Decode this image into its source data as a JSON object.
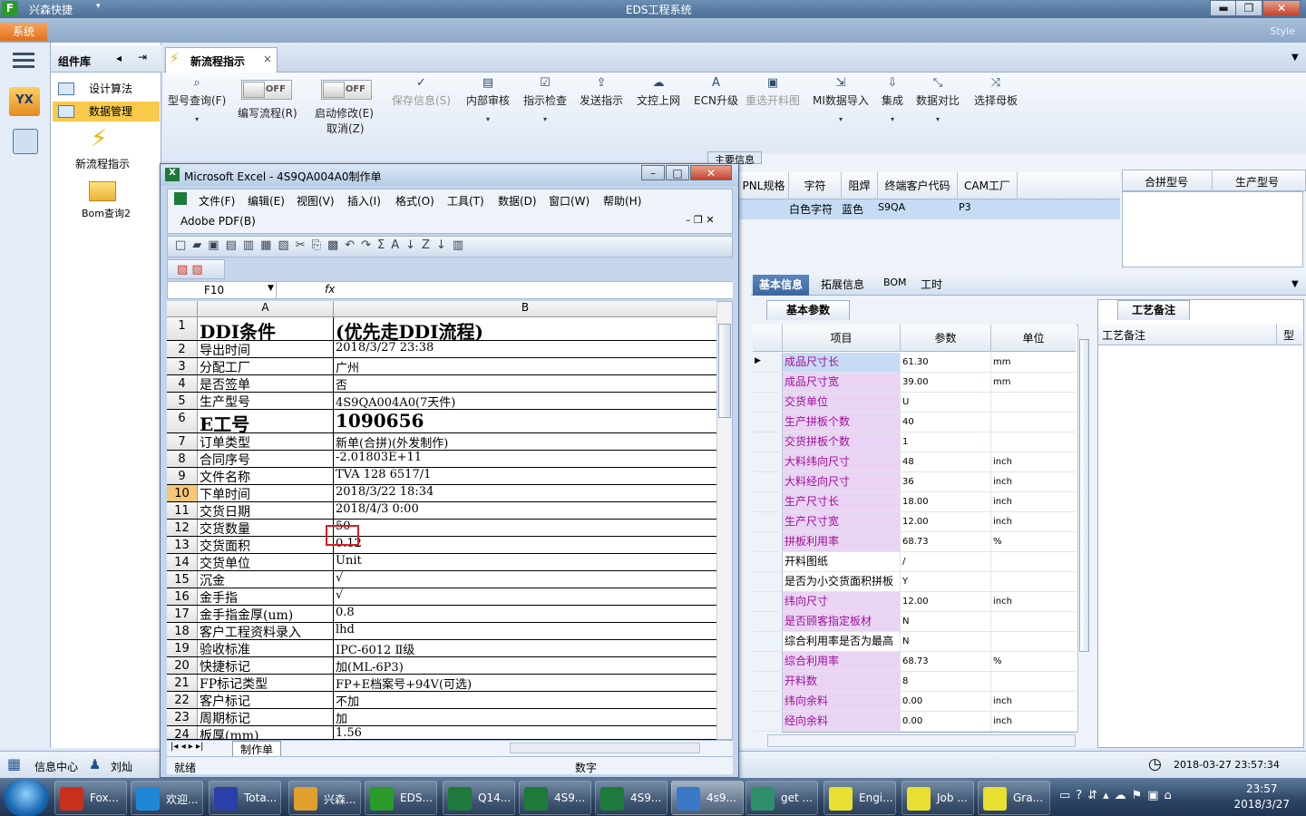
{
  "window": {
    "app_name": "兴森快捷",
    "title": "EDS工程系统",
    "system_tab": "系统",
    "style_label": "Style"
  },
  "component_library": {
    "title": "组件库",
    "items": [
      "设计算法",
      "数据管理"
    ],
    "icons": [
      "新流程指示",
      "Bom查询2"
    ]
  },
  "tabs": {
    "active": "新流程指示"
  },
  "toolbar": {
    "buttons": [
      {
        "label": "型号查询(F)",
        "icon": "search-icon"
      },
      {
        "label": "编写流程(R)",
        "toggle": "OFF"
      },
      {
        "label": "启动修改(E)",
        "label2": "取消(Z)",
        "toggle": "OFF"
      },
      {
        "label": "保存信息(S)",
        "icon": "check-icon",
        "disabled": true
      },
      {
        "label": "内部审核",
        "icon": "print-icon"
      },
      {
        "label": "指示检查",
        "icon": "checkbox-icon"
      },
      {
        "label": "发送指示",
        "icon": "upload-icon"
      },
      {
        "label": "文控上网",
        "icon": "cloud-upload-icon"
      },
      {
        "label": "ECN升级",
        "icon": "ecn-icon"
      },
      {
        "label": "重选开料图",
        "icon": "image-icon",
        "disabled": true
      },
      {
        "label": "MI数据导入",
        "icon": "import-icon"
      },
      {
        "label": "集成",
        "icon": "download-icon"
      },
      {
        "label": "数据对比",
        "icon": "compare-icon"
      },
      {
        "label": "选择母板",
        "icon": "shuffle-icon"
      }
    ]
  },
  "main_info": {
    "label": "主要信息",
    "columns": [
      "PNL规格",
      "字符",
      "阻焊",
      "终端客户代码",
      "CAM工厂"
    ],
    "row": [
      "",
      "白色字符",
      "蓝色",
      "S9QA",
      "P3"
    ],
    "columns2": [
      "合拼型号",
      "生产型号"
    ]
  },
  "sub_tabs": [
    "基本信息",
    "拓展信息",
    "BOM",
    "工时"
  ],
  "params": {
    "tab": "基本参数",
    "headers": [
      "项目",
      "参数",
      "单位"
    ],
    "rows": [
      {
        "item": "成品尺寸长",
        "value": "61.30",
        "unit": "mm",
        "pink": true
      },
      {
        "item": "成品尺寸宽",
        "value": "39.00",
        "unit": "mm",
        "pink": true
      },
      {
        "item": "交货单位",
        "value": "U",
        "unit": "",
        "pink": true
      },
      {
        "item": "生产拼板个数",
        "value": "40",
        "unit": "",
        "pink": true
      },
      {
        "item": "交货拼板个数",
        "value": "1",
        "unit": "",
        "pink": true
      },
      {
        "item": "大料纬向尺寸",
        "value": "48",
        "unit": "inch",
        "pink": true
      },
      {
        "item": "大料经向尺寸",
        "value": "36",
        "unit": "inch",
        "pink": true
      },
      {
        "item": "生产尺寸长",
        "value": "18.00",
        "unit": "inch",
        "pink": true
      },
      {
        "item": "生产尺寸宽",
        "value": "12.00",
        "unit": "inch",
        "pink": true
      },
      {
        "item": "拼板利用率",
        "value": "68.73",
        "unit": "%",
        "pink": true
      },
      {
        "item": "开料图纸",
        "value": "/",
        "unit": "",
        "pink": false
      },
      {
        "item": "是否为小交货面积拼板",
        "value": "Y",
        "unit": "",
        "pink": false
      },
      {
        "item": "纬向尺寸",
        "value": "12.00",
        "unit": "inch",
        "pink": true
      },
      {
        "item": "是否顾客指定板材",
        "value": "N",
        "unit": "",
        "pink": true
      },
      {
        "item": "综合利用率是否为最高",
        "value": "N",
        "unit": "",
        "pink": false
      },
      {
        "item": "综合利用率",
        "value": "68.73",
        "unit": "%",
        "pink": true
      },
      {
        "item": "开料数",
        "value": "8",
        "unit": "",
        "pink": true
      },
      {
        "item": "纬向余料",
        "value": "0.00",
        "unit": "inch",
        "pink": true
      },
      {
        "item": "经向余料",
        "value": "0.00",
        "unit": "inch",
        "pink": true
      }
    ]
  },
  "craft": {
    "tab": "工艺备注",
    "header": "工艺备注",
    "col2": "型"
  },
  "app_status": {
    "info_center": "信息中心",
    "user": "刘灿",
    "datetime": "2018-03-27 23:57:34"
  },
  "excel": {
    "title": "Microsoft Excel - 4S9QA004A0制作单",
    "menus": [
      "文件(F)",
      "编辑(E)",
      "视图(V)",
      "插入(I)",
      "格式(O)",
      "工具(T)",
      "数据(D)",
      "窗口(W)",
      "帮助(H)"
    ],
    "menu2": "Adobe PDF(B)",
    "name_box": "F10",
    "fx": "fx",
    "col_a": "A",
    "col_b": "B",
    "rows": [
      {
        "n": "1",
        "a": "DDI条件",
        "b": "(优先走DDI流程)",
        "big": true
      },
      {
        "n": "2",
        "a": "导出时间",
        "b": "2018/3/27 23:38"
      },
      {
        "n": "3",
        "a": "分配工厂",
        "b": "广州"
      },
      {
        "n": "4",
        "a": "是否签单",
        "b": "否"
      },
      {
        "n": "5",
        "a": "生产型号",
        "b": "4S9QA004A0(7天件)"
      },
      {
        "n": "6",
        "a": "E工号",
        "b": "1090656",
        "big": true
      },
      {
        "n": "7",
        "a": "订单类型",
        "b": "新单(合拼)(外发制作)"
      },
      {
        "n": "8",
        "a": "合同序号",
        "b": "-2.01803E+11"
      },
      {
        "n": "9",
        "a": "文件名称",
        "b": "TVA 128 6517/1"
      },
      {
        "n": "10",
        "a": "下单时间",
        "b": "2018/3/22 18:34"
      },
      {
        "n": "11",
        "a": "交货日期",
        "b": "2018/4/3 0:00"
      },
      {
        "n": "12",
        "a": "交货数量",
        "b": "50"
      },
      {
        "n": "13",
        "a": "交货面积",
        "b": "0.12"
      },
      {
        "n": "14",
        "a": "交货单位",
        "b": "Unit"
      },
      {
        "n": "15",
        "a": "沉金",
        "b": "√"
      },
      {
        "n": "16",
        "a": "金手指",
        "b": "√"
      },
      {
        "n": "17",
        "a": "金手指金厚(um)",
        "b": "0.8"
      },
      {
        "n": "18",
        "a": "客户工程资料录入",
        "b": "lhd"
      },
      {
        "n": "19",
        "a": "验收标准",
        "b": "IPC-6012 Ⅱ级"
      },
      {
        "n": "20",
        "a": "快捷标记",
        "b": "加(ML-6P3)"
      },
      {
        "n": "21",
        "a": "FP标记类型",
        "b": "FP+E档案号+94V(可选)"
      },
      {
        "n": "22",
        "a": "客户标记",
        "b": "不加"
      },
      {
        "n": "23",
        "a": "周期标记",
        "b": "加"
      },
      {
        "n": "24",
        "a": "板厚(mm)",
        "b": "1.56"
      }
    ],
    "sheet_tab": "制作单",
    "status_ready": "就绪",
    "status_num": "数字"
  },
  "taskbar": {
    "items": [
      "Fox...",
      "欢迎...",
      "Tota...",
      "兴森...",
      "EDS...",
      "Q14...",
      "4S9...",
      "4S9...",
      "4s9...",
      "get ...",
      "Engi...",
      "Job ...",
      "Gra..."
    ],
    "time": "23:57",
    "date": "2018/3/27"
  }
}
